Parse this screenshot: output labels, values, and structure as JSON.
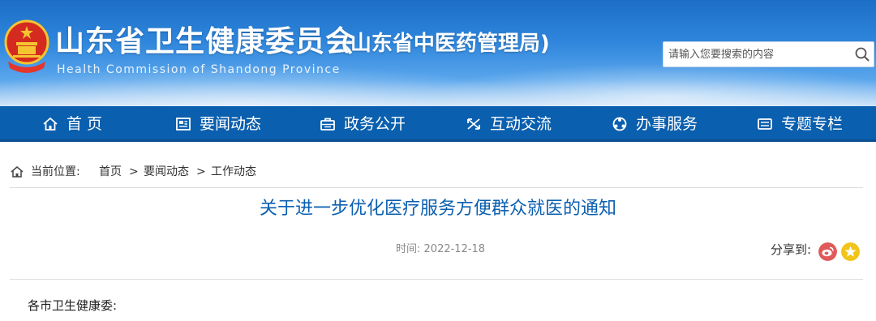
{
  "header": {
    "title": "山东省卫生健康委员会",
    "subtitle": "(山东省中医药管理局)",
    "english_name": "Health Commission of Shandong Province",
    "search_placeholder": "请输入您要搜索的内容"
  },
  "nav": {
    "items": [
      {
        "label": "首 页",
        "icon": "home-icon"
      },
      {
        "label": "要闻动态",
        "icon": "newspaper-icon"
      },
      {
        "label": "政务公开",
        "icon": "briefcase-icon"
      },
      {
        "label": "互动交流",
        "icon": "exchange-icon"
      },
      {
        "label": "办事服务",
        "icon": "service-icon"
      },
      {
        "label": "专题专栏",
        "icon": "column-icon"
      }
    ]
  },
  "breadcrumb": {
    "prefix": "当前位置:",
    "items": [
      "首页",
      "要闻动态",
      "工作动态"
    ],
    "separator": ">"
  },
  "article": {
    "title": "关于进一步优化医疗服务方便群众就医的通知",
    "time_label": "时间:",
    "date": "2022-12-18",
    "share_label": "分享到:",
    "greeting": "各市卫生健康委:"
  },
  "colors": {
    "nav_bg": "#0a5fae",
    "title_blue": "#0b5fb0",
    "weibo": "#e05a5a",
    "qzone": "#f0c419"
  }
}
